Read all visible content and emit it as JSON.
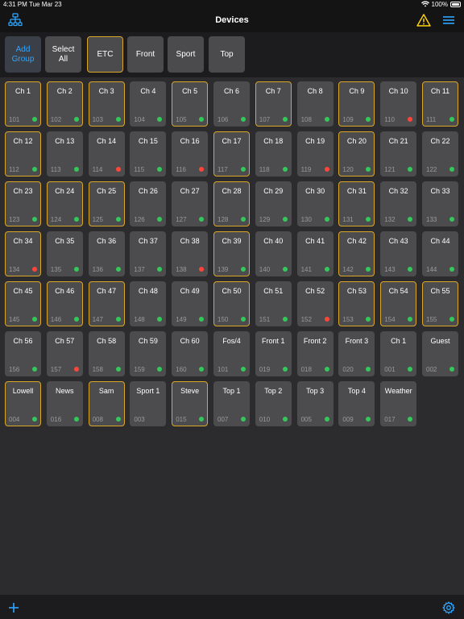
{
  "status": {
    "time": "4:31 PM",
    "date": "Tue Mar 23",
    "battery": "100%"
  },
  "nav": {
    "title": "Devices"
  },
  "groups": [
    {
      "label": "Add\nGroup",
      "type": "add",
      "selected": false
    },
    {
      "label": "Select\nAll",
      "type": "normal",
      "selected": false
    },
    {
      "label": "ETC",
      "type": "normal",
      "selected": true
    },
    {
      "label": "Front",
      "type": "normal",
      "selected": false
    },
    {
      "label": "Sport",
      "type": "normal",
      "selected": false
    },
    {
      "label": "Top",
      "type": "normal",
      "selected": false
    }
  ],
  "devices": [
    {
      "name": "Ch 1",
      "num": "101",
      "sel": true,
      "status": "ok"
    },
    {
      "name": "Ch 2",
      "num": "102",
      "sel": true,
      "status": "ok"
    },
    {
      "name": "Ch 3",
      "num": "103",
      "sel": true,
      "status": "ok"
    },
    {
      "name": "Ch 4",
      "num": "104",
      "sel": false,
      "status": "ok"
    },
    {
      "name": "Ch 5",
      "num": "105",
      "sel": true,
      "status": "ok"
    },
    {
      "name": "Ch 6",
      "num": "106",
      "sel": false,
      "status": "ok"
    },
    {
      "name": "Ch 7",
      "num": "107",
      "sel": true,
      "status": "ok"
    },
    {
      "name": "Ch 8",
      "num": "108",
      "sel": false,
      "status": "ok"
    },
    {
      "name": "Ch 9",
      "num": "109",
      "sel": true,
      "status": "ok"
    },
    {
      "name": "Ch 10",
      "num": "110",
      "sel": false,
      "status": "error"
    },
    {
      "name": "Ch 11",
      "num": "111",
      "sel": true,
      "status": "ok"
    },
    {
      "name": "Ch 12",
      "num": "112",
      "sel": true,
      "status": "ok"
    },
    {
      "name": "Ch 13",
      "num": "113",
      "sel": false,
      "status": "ok"
    },
    {
      "name": "Ch 14",
      "num": "114",
      "sel": false,
      "status": "error"
    },
    {
      "name": "Ch 15",
      "num": "115",
      "sel": false,
      "status": "ok"
    },
    {
      "name": "Ch 16",
      "num": "116",
      "sel": false,
      "status": "error"
    },
    {
      "name": "Ch 17",
      "num": "117",
      "sel": true,
      "status": "ok"
    },
    {
      "name": "Ch 18",
      "num": "118",
      "sel": false,
      "status": "ok"
    },
    {
      "name": "Ch 19",
      "num": "119",
      "sel": false,
      "status": "error"
    },
    {
      "name": "Ch 20",
      "num": "120",
      "sel": true,
      "status": "ok"
    },
    {
      "name": "Ch 21",
      "num": "121",
      "sel": false,
      "status": "ok"
    },
    {
      "name": "Ch 22",
      "num": "122",
      "sel": false,
      "status": "ok"
    },
    {
      "name": "Ch 23",
      "num": "123",
      "sel": true,
      "status": "ok"
    },
    {
      "name": "Ch 24",
      "num": "124",
      "sel": true,
      "status": "ok"
    },
    {
      "name": "Ch 25",
      "num": "125",
      "sel": true,
      "status": "ok"
    },
    {
      "name": "Ch 26",
      "num": "126",
      "sel": false,
      "status": "ok"
    },
    {
      "name": "Ch 27",
      "num": "127",
      "sel": false,
      "status": "ok"
    },
    {
      "name": "Ch 28",
      "num": "128",
      "sel": true,
      "status": "ok"
    },
    {
      "name": "Ch 29",
      "num": "129",
      "sel": false,
      "status": "ok"
    },
    {
      "name": "Ch 30",
      "num": "130",
      "sel": false,
      "status": "ok"
    },
    {
      "name": "Ch 31",
      "num": "131",
      "sel": true,
      "status": "ok"
    },
    {
      "name": "Ch 32",
      "num": "132",
      "sel": false,
      "status": "ok"
    },
    {
      "name": "Ch 33",
      "num": "133",
      "sel": false,
      "status": "ok"
    },
    {
      "name": "Ch 34",
      "num": "134",
      "sel": true,
      "status": "error"
    },
    {
      "name": "Ch 35",
      "num": "135",
      "sel": false,
      "status": "ok"
    },
    {
      "name": "Ch 36",
      "num": "136",
      "sel": false,
      "status": "ok"
    },
    {
      "name": "Ch 37",
      "num": "137",
      "sel": false,
      "status": "ok"
    },
    {
      "name": "Ch 38",
      "num": "138",
      "sel": false,
      "status": "error"
    },
    {
      "name": "Ch 39",
      "num": "139",
      "sel": true,
      "status": "ok"
    },
    {
      "name": "Ch 40",
      "num": "140",
      "sel": false,
      "status": "ok"
    },
    {
      "name": "Ch 41",
      "num": "141",
      "sel": false,
      "status": "ok"
    },
    {
      "name": "Ch 42",
      "num": "142",
      "sel": true,
      "status": "ok"
    },
    {
      "name": "Ch 43",
      "num": "143",
      "sel": false,
      "status": "ok"
    },
    {
      "name": "Ch 44",
      "num": "144",
      "sel": false,
      "status": "ok"
    },
    {
      "name": "Ch 45",
      "num": "145",
      "sel": true,
      "status": "ok"
    },
    {
      "name": "Ch 46",
      "num": "146",
      "sel": true,
      "status": "ok"
    },
    {
      "name": "Ch 47",
      "num": "147",
      "sel": true,
      "status": "ok"
    },
    {
      "name": "Ch 48",
      "num": "148",
      "sel": false,
      "status": "ok"
    },
    {
      "name": "Ch 49",
      "num": "149",
      "sel": false,
      "status": "ok"
    },
    {
      "name": "Ch 50",
      "num": "150",
      "sel": true,
      "status": "ok"
    },
    {
      "name": "Ch 51",
      "num": "151",
      "sel": false,
      "status": "ok"
    },
    {
      "name": "Ch 52",
      "num": "152",
      "sel": false,
      "status": "error"
    },
    {
      "name": "Ch 53",
      "num": "153",
      "sel": true,
      "status": "ok"
    },
    {
      "name": "Ch 54",
      "num": "154",
      "sel": true,
      "status": "ok"
    },
    {
      "name": "Ch 55",
      "num": "155",
      "sel": true,
      "status": "ok"
    },
    {
      "name": "Ch 56",
      "num": "156",
      "sel": false,
      "status": "ok"
    },
    {
      "name": "Ch 57",
      "num": "157",
      "sel": false,
      "status": "error"
    },
    {
      "name": "Ch 58",
      "num": "158",
      "sel": false,
      "status": "ok"
    },
    {
      "name": "Ch 59",
      "num": "159",
      "sel": false,
      "status": "ok"
    },
    {
      "name": "Ch 60",
      "num": "160",
      "sel": false,
      "status": "ok"
    },
    {
      "name": "Fos/4",
      "num": "101",
      "sel": false,
      "status": "ok"
    },
    {
      "name": "Front 1",
      "num": "019",
      "sel": false,
      "status": "ok"
    },
    {
      "name": "Front 2",
      "num": "018",
      "sel": false,
      "status": "ok"
    },
    {
      "name": "Front 3",
      "num": "020",
      "sel": false,
      "status": "ok"
    },
    {
      "name": "Ch 1",
      "num": "001",
      "sel": false,
      "status": "ok"
    },
    {
      "name": "Guest",
      "num": "002",
      "sel": false,
      "status": "ok"
    },
    {
      "name": "Lowell",
      "num": "004",
      "sel": true,
      "status": "ok"
    },
    {
      "name": "News",
      "num": "016",
      "sel": false,
      "status": "ok"
    },
    {
      "name": "Sam",
      "num": "008",
      "sel": true,
      "status": "ok"
    },
    {
      "name": "Sport 1",
      "num": "003",
      "sel": false,
      "status": "none"
    },
    {
      "name": "Steve",
      "num": "015",
      "sel": true,
      "status": "ok"
    },
    {
      "name": "Top 1",
      "num": "007",
      "sel": false,
      "status": "ok"
    },
    {
      "name": "Top 2",
      "num": "010",
      "sel": false,
      "status": "ok"
    },
    {
      "name": "Top 3",
      "num": "005",
      "sel": false,
      "status": "ok"
    },
    {
      "name": "Top 4",
      "num": "009",
      "sel": false,
      "status": "ok"
    },
    {
      "name": "Weather",
      "num": "017",
      "sel": false,
      "status": "ok"
    }
  ],
  "colors": {
    "accent": "#2ea6ff",
    "selected_border": "#d9a625",
    "status_ok": "#34c759",
    "status_error": "#ff453a",
    "warning": "#ffd60a"
  },
  "icons": {
    "nav_left": "network-icon",
    "nav_warning": "warning-icon",
    "nav_menu": "menu-icon",
    "bottom_left": "add-icon",
    "bottom_right": "settings-icon"
  }
}
